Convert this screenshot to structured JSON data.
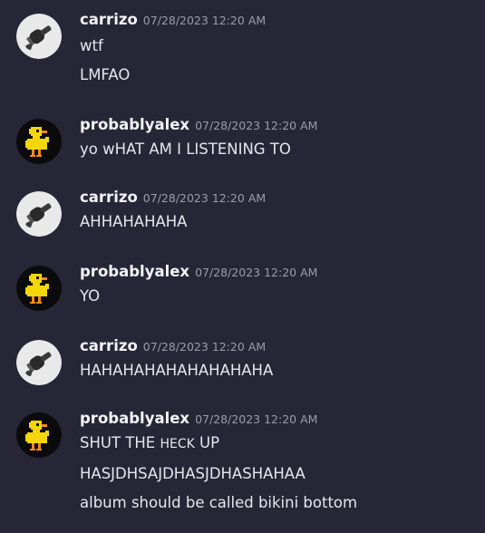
{
  "messages": [
    {
      "username": "carrizo",
      "timestamp": "07/28/2023 12:20 AM",
      "lines": [
        "wtf",
        "LMFAO"
      ]
    },
    {
      "username": "probablyalex",
      "timestamp": "07/28/2023 12:20 AM",
      "lines": [
        "yo wHAT AM I LISTENING TO"
      ]
    },
    {
      "username": "carrizo",
      "timestamp": "07/28/2023 12:20 AM",
      "lines": [
        "AHHAHAHAHA"
      ]
    },
    {
      "username": "probablyalex",
      "timestamp": "07/28/2023 12:20 AM",
      "lines": [
        "YO"
      ]
    },
    {
      "username": "carrizo",
      "timestamp": "07/28/2023 12:20 AM",
      "lines": [
        "HAHAHAHAHAHAHAHAHA"
      ]
    },
    {
      "username": "probablyalex",
      "timestamp": "07/28/2023 12:20 AM",
      "lines_first_parts": [
        "SHUT THE ",
        "HECK",
        " UP"
      ],
      "lines": [
        "HASJDHSAJDHASJDHASHAHAA",
        "album should be called bikini bottom"
      ]
    }
  ],
  "colors": {
    "background": "#262637",
    "username": "#f2f3f5",
    "timestamp": "#9a9cab",
    "text": "#e6e7ea",
    "duck_yellow": "#f5d60a"
  },
  "icons": {
    "carrizo_avatar": "microphone-avatar-icon",
    "probablyalex_avatar": "pixel-duck-avatar-icon"
  }
}
